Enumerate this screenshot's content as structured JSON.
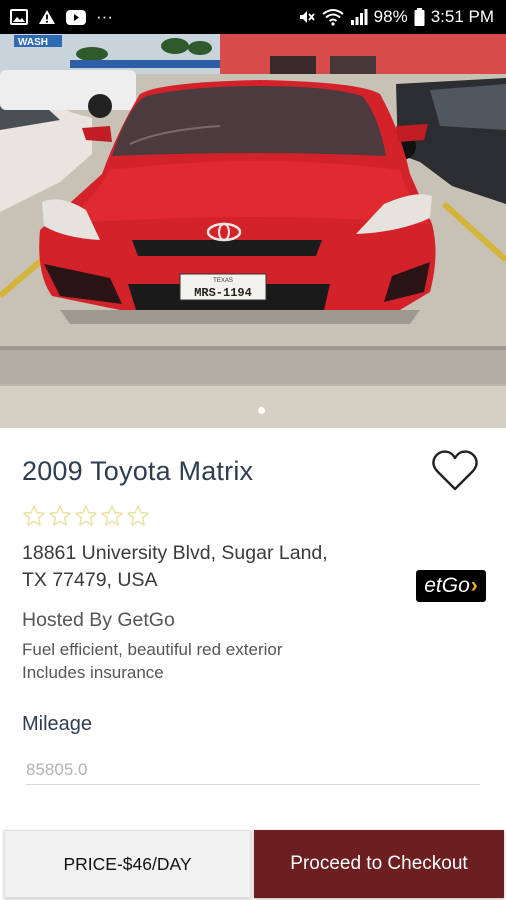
{
  "status_bar": {
    "battery": "98%",
    "time": "3:51 PM",
    "more": "···"
  },
  "hero": {
    "plate_state": "TEXAS",
    "plate_number": "MRS-1194",
    "sign_text": "WASH"
  },
  "listing": {
    "title": "2009 Toyota Matrix",
    "rating": 0,
    "rating_max": 5,
    "address_line1": "18861 University Blvd, Sugar Land,",
    "address_line2": "TX 77479, USA",
    "host_logo_text": "etGo",
    "hosted_by": "Hosted By GetGo",
    "desc_line1": "Fuel efficient, beautiful red exterior",
    "desc_line2": "Includes insurance",
    "mileage_label": "Mileage",
    "mileage_value": "85805.0"
  },
  "footer": {
    "price_label": "PRICE-$46/DAY",
    "checkout_label": "Proceed to Checkout"
  },
  "colors": {
    "accent": "#6c1f20",
    "title": "#2f3d52",
    "star_outline": "#e9e2a4"
  }
}
